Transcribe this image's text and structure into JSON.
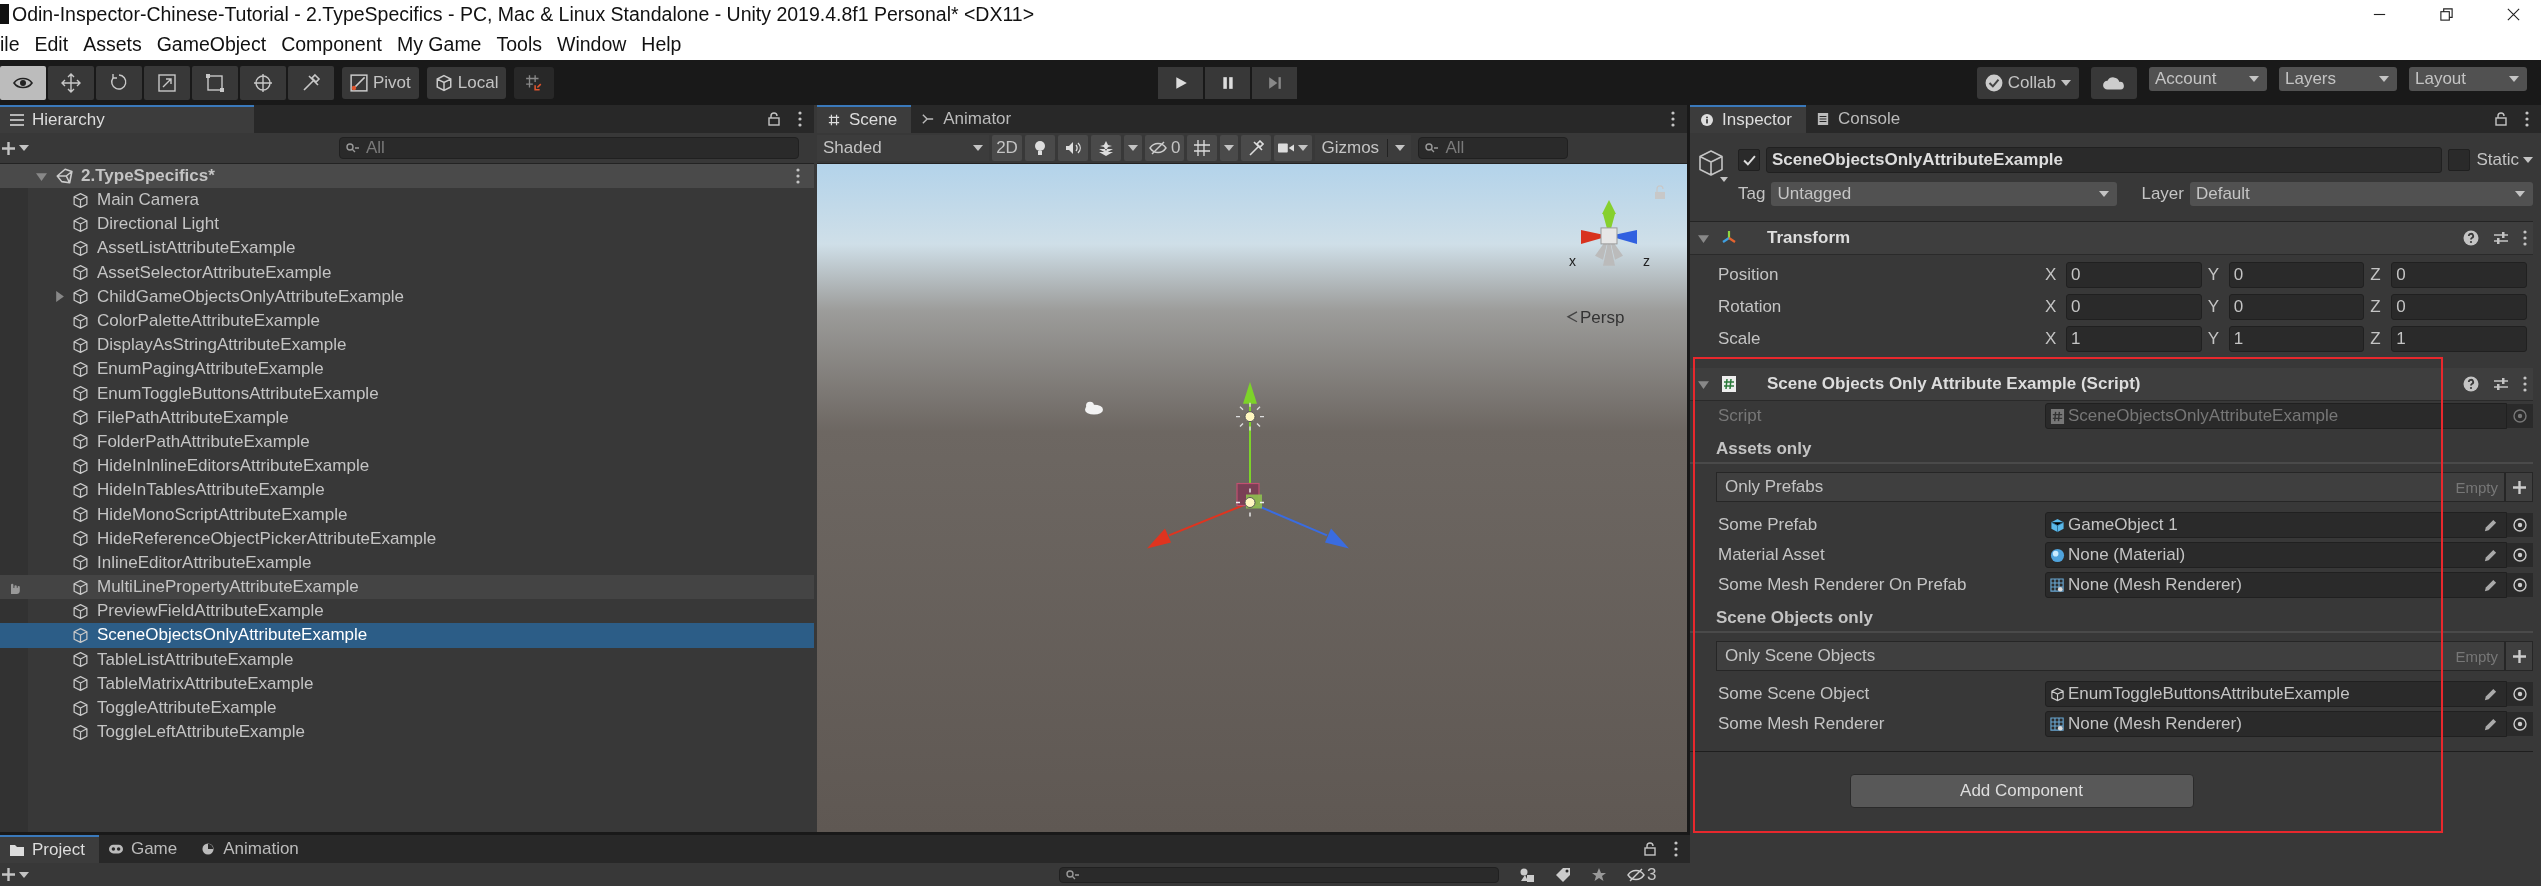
{
  "window": {
    "title": "Odin-Inspector-Chinese-Tutorial - 2.TypeSpecifics - PC, Mac & Linux Standalone - Unity 2019.4.8f1 Personal* <DX11>"
  },
  "menu": [
    "ile",
    "Edit",
    "Assets",
    "GameObject",
    "Component",
    "My Game",
    "Tools",
    "Window",
    "Help"
  ],
  "toolbar": {
    "tools": [
      {
        "kind": "view",
        "selected": true
      },
      {
        "kind": "move",
        "selected": false
      },
      {
        "kind": "rotate",
        "selected": false
      },
      {
        "kind": "scale",
        "selected": false
      },
      {
        "kind": "rect",
        "selected": false
      },
      {
        "kind": "transform",
        "selected": false
      },
      {
        "kind": "custom",
        "selected": false
      }
    ],
    "pivot": "Pivot",
    "space": "Local",
    "collab": "Collab",
    "account": "Account",
    "layers": "Layers",
    "layout": "Layout"
  },
  "hierarchy": {
    "tab": "Hierarchy",
    "search_placeholder": "All",
    "scene": {
      "name": "2.TypeSpecifics*",
      "expanded": true
    },
    "items": [
      {
        "name": "Main Camera",
        "selected": false,
        "hovered": false,
        "expandable": false
      },
      {
        "name": "Directional Light",
        "selected": false,
        "hovered": false,
        "expandable": false
      },
      {
        "name": "AssetListAttributeExample",
        "selected": false,
        "hovered": false,
        "expandable": false
      },
      {
        "name": "AssetSelectorAttributeExample",
        "selected": false,
        "hovered": false,
        "expandable": false
      },
      {
        "name": "ChildGameObjectsOnlyAttributeExample",
        "selected": false,
        "hovered": false,
        "expandable": true
      },
      {
        "name": "ColorPaletteAttributeExample",
        "selected": false,
        "hovered": false,
        "expandable": false
      },
      {
        "name": "DisplayAsStringAttributeExample",
        "selected": false,
        "hovered": false,
        "expandable": false
      },
      {
        "name": "EnumPagingAttributeExample",
        "selected": false,
        "hovered": false,
        "expandable": false
      },
      {
        "name": "EnumToggleButtonsAttributeExample",
        "selected": false,
        "hovered": false,
        "expandable": false
      },
      {
        "name": "FilePathAttributeExample",
        "selected": false,
        "hovered": false,
        "expandable": false
      },
      {
        "name": "FolderPathAttributeExample",
        "selected": false,
        "hovered": false,
        "expandable": false
      },
      {
        "name": "HideInInlineEditorsAttributeExample",
        "selected": false,
        "hovered": false,
        "expandable": false
      },
      {
        "name": "HideInTablesAttributeExample",
        "selected": false,
        "hovered": false,
        "expandable": false
      },
      {
        "name": "HideMonoScriptAttributeExample",
        "selected": false,
        "hovered": false,
        "expandable": false
      },
      {
        "name": "HideReferenceObjectPickerAttributeExample",
        "selected": false,
        "hovered": false,
        "expandable": false
      },
      {
        "name": "InlineEditorAttributeExample",
        "selected": false,
        "hovered": false,
        "expandable": false
      },
      {
        "name": "MultiLinePropertyAttributeExample",
        "selected": false,
        "hovered": true,
        "expandable": false
      },
      {
        "name": "PreviewFieldAttributeExample",
        "selected": false,
        "hovered": false,
        "expandable": false
      },
      {
        "name": "SceneObjectsOnlyAttributeExample",
        "selected": true,
        "hovered": false,
        "expandable": false
      },
      {
        "name": "TableListAttributeExample",
        "selected": false,
        "hovered": false,
        "expandable": false
      },
      {
        "name": "TableMatrixAttributeExample",
        "selected": false,
        "hovered": false,
        "expandable": false
      },
      {
        "name": "ToggleAttributeExample",
        "selected": false,
        "hovered": false,
        "expandable": false
      },
      {
        "name": "ToggleLeftAttributeExample",
        "selected": false,
        "hovered": false,
        "expandable": false
      }
    ]
  },
  "scene": {
    "tabs": [
      {
        "label": "Scene",
        "selected": true,
        "kind": "scene"
      },
      {
        "label": "Animator",
        "selected": false,
        "kind": "animator"
      }
    ],
    "shading": "Shaded",
    "mode_2d": "2D",
    "hidden_count": "0",
    "gizmos": "Gizmos",
    "search_placeholder": "All",
    "camera_label": "Persp",
    "axis_labels": [
      "x",
      "z"
    ]
  },
  "inspector": {
    "tabs": [
      {
        "label": "Inspector",
        "selected": true,
        "kind": "info"
      },
      {
        "label": "Console",
        "selected": false,
        "kind": "console"
      }
    ],
    "object": {
      "name": "SceneObjectsOnlyAttributeExample",
      "active": true,
      "static": false,
      "static_label": "Static",
      "tag_label": "Tag",
      "tag": "Untagged",
      "layer_label": "Layer",
      "layer": "Default"
    },
    "transform": {
      "title": "Transform",
      "expanded": true,
      "rows": [
        {
          "label": "Position",
          "values": [
            {
              "axis": "X",
              "value": "0"
            },
            {
              "axis": "Y",
              "value": "0"
            },
            {
              "axis": "Z",
              "value": "0"
            }
          ]
        },
        {
          "label": "Rotation",
          "values": [
            {
              "axis": "X",
              "value": "0"
            },
            {
              "axis": "Y",
              "value": "0"
            },
            {
              "axis": "Z",
              "value": "0"
            }
          ]
        },
        {
          "label": "Scale",
          "values": [
            {
              "axis": "X",
              "value": "1"
            },
            {
              "axis": "Y",
              "value": "1"
            },
            {
              "axis": "Z",
              "value": "1"
            }
          ]
        }
      ]
    },
    "script_component": {
      "title": "Scene Objects Only Attribute Example (Script)",
      "expanded": true,
      "script_label": "Script",
      "script_value": "SceneObjectsOnlyAttributeExample",
      "sections": [
        {
          "title": "Assets only",
          "list": {
            "label": "Only Prefabs",
            "empty": "Empty"
          },
          "fields": [
            {
              "label": "Some Prefab",
              "value": "GameObject 1",
              "kind": "prefab"
            },
            {
              "label": "Material Asset",
              "value": "None (Material)",
              "kind": "material"
            },
            {
              "label": "Some Mesh Renderer On Prefab",
              "value": "None (Mesh Renderer)",
              "kind": "mesh"
            }
          ]
        },
        {
          "title": "Scene Objects only",
          "list": {
            "label": "Only Scene Objects",
            "empty": "Empty"
          },
          "fields": [
            {
              "label": "Some Scene Object",
              "value": "EnumToggleButtonsAttributeExample",
              "kind": "gameobject"
            },
            {
              "label": "Some Mesh Renderer",
              "value": "None (Mesh Renderer)",
              "kind": "mesh"
            }
          ]
        }
      ]
    },
    "add_component": "Add Component"
  },
  "project": {
    "tabs": [
      {
        "label": "Project",
        "selected": true,
        "kind": "folder"
      },
      {
        "label": "Game",
        "selected": false,
        "kind": "game"
      },
      {
        "label": "Animation",
        "selected": false,
        "kind": "animation"
      }
    ],
    "hidden_count": "3"
  }
}
